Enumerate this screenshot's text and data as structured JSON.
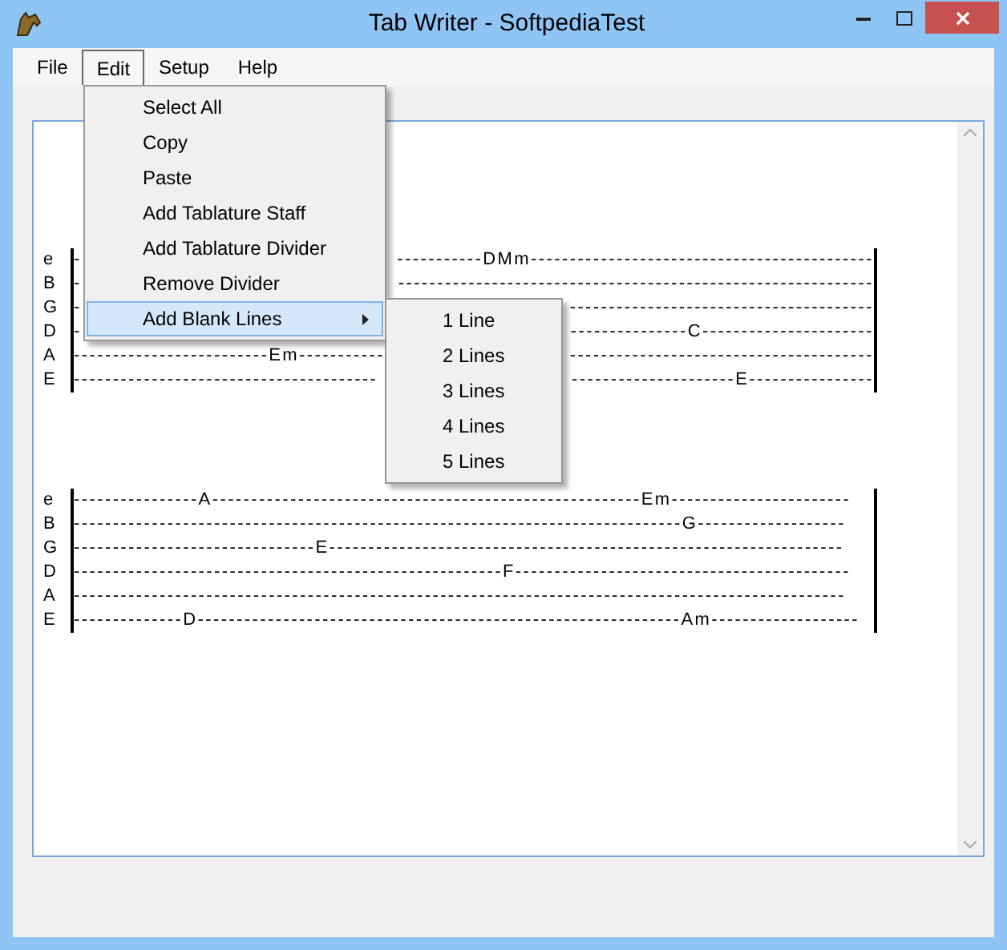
{
  "window": {
    "title": "Tab Writer - SoftpediaTest"
  },
  "menu_bar": [
    {
      "label": "File",
      "selected": false
    },
    {
      "label": "Edit",
      "selected": true
    },
    {
      "label": "Setup",
      "selected": false
    },
    {
      "label": "Help",
      "selected": false
    }
  ],
  "edit_menu": [
    {
      "label": "Select All",
      "highlighted": false,
      "has_submenu": false
    },
    {
      "label": "Copy",
      "highlighted": false,
      "has_submenu": false
    },
    {
      "label": "Paste",
      "highlighted": false,
      "has_submenu": false
    },
    {
      "label": "Add Tablature Staff",
      "highlighted": false,
      "has_submenu": false
    },
    {
      "label": "Add Tablature Divider",
      "highlighted": false,
      "has_submenu": false
    },
    {
      "label": "Remove Divider",
      "highlighted": false,
      "has_submenu": false
    },
    {
      "label": "Add Blank Lines",
      "highlighted": true,
      "has_submenu": true
    }
  ],
  "submenu": [
    "1 Line",
    "2 Lines",
    "3 Lines",
    "4 Lines",
    "5 Lines"
  ],
  "staffs": [
    {
      "rows": [
        {
          "string": "e",
          "segments": [
            "-",
            "-----------DMm--------------------------------------------"
          ]
        },
        {
          "string": "B",
          "segments": [
            "-",
            "-------------------------------------------------------------"
          ]
        },
        {
          "string": "G",
          "segments": [
            "-",
            "---------------------------------------"
          ]
        },
        {
          "string": "D",
          "segments": [
            "-",
            "---------------C----------------------"
          ]
        },
        {
          "string": "A",
          "segments": [
            "-------------------------Em-----------",
            "---------------------------------------"
          ]
        },
        {
          "string": "E",
          "segments": [
            "---------------------------------------",
            "---------------------E----------------"
          ]
        }
      ]
    },
    {
      "rows": [
        {
          "string": "e",
          "segments": [
            "----------------A-------------------------------------------------------Em-----------------------"
          ]
        },
        {
          "string": "B",
          "segments": [
            "------------------------------------------------------------------------------G-------------------"
          ]
        },
        {
          "string": "G",
          "segments": [
            "-------------------------------E------------------------------------------------------------------"
          ]
        },
        {
          "string": "D",
          "segments": [
            "-------------------------------------------------------F-------------------------------------------"
          ]
        },
        {
          "string": "A",
          "segments": [
            "---------------------------------------------------------------------------------------------------"
          ]
        },
        {
          "string": "E",
          "segments": [
            "--------------D--------------------------------------------------------------Am-------------------"
          ]
        }
      ]
    }
  ]
}
